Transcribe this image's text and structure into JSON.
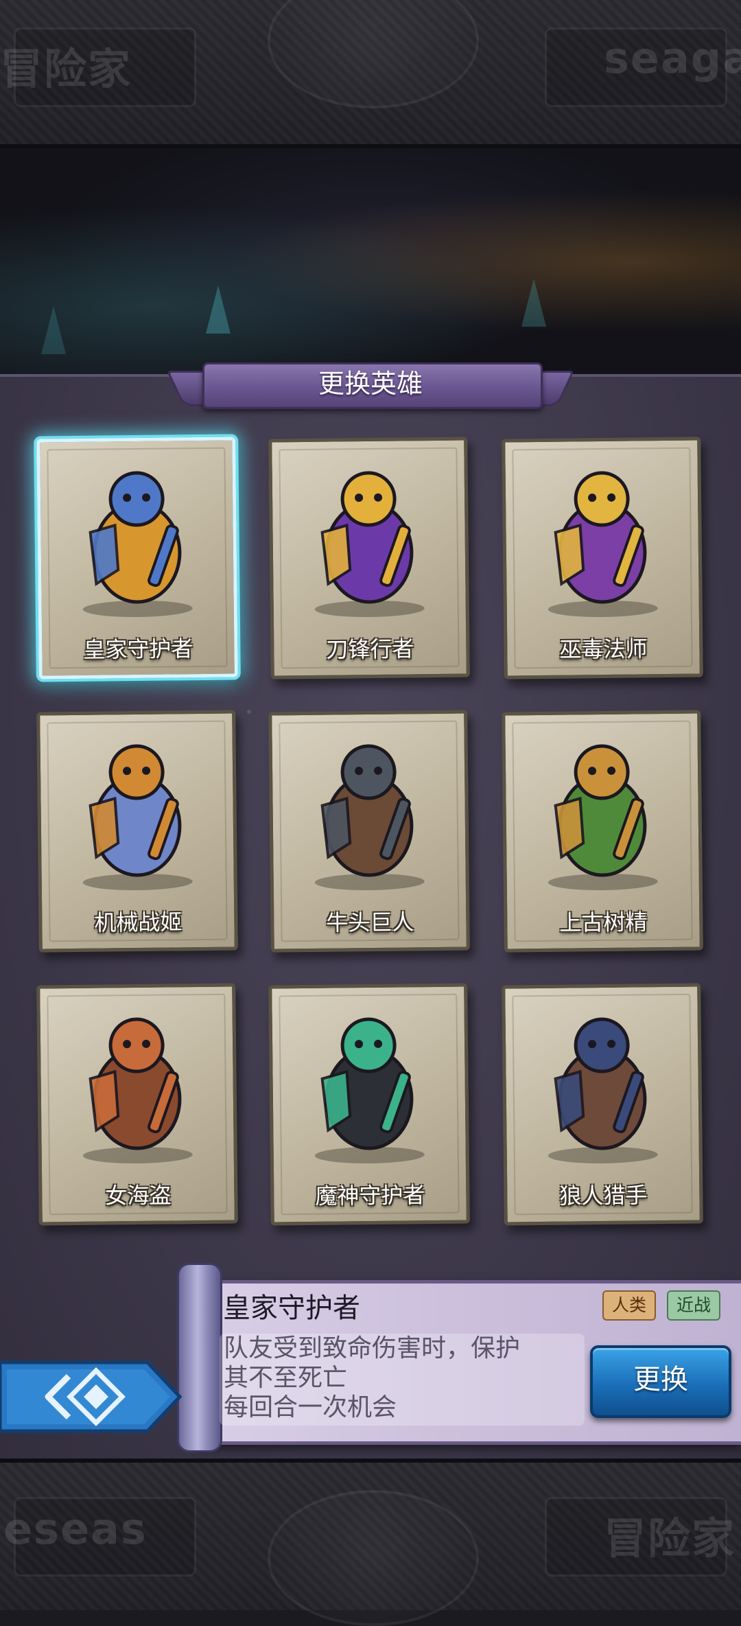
{
  "frame": {
    "top_left_text": "冒险家",
    "top_right_text": "seaga",
    "bottom_left_text": "eseas",
    "bottom_right_text": "冒险家"
  },
  "dialog": {
    "title": "更换英雄"
  },
  "heroes": [
    {
      "name": "皇家守护者",
      "selected": true,
      "theme": "#d8962f",
      "accent": "#4f79c8"
    },
    {
      "name": "刀锋行者",
      "selected": false,
      "theme": "#6b3aa8",
      "accent": "#e3b03c"
    },
    {
      "name": "巫毒法师",
      "selected": false,
      "theme": "#7b3fa6",
      "accent": "#e2b440"
    },
    {
      "name": "机械战姬",
      "selected": false,
      "theme": "#6f86c9",
      "accent": "#d18a33"
    },
    {
      "name": "牛头巨人",
      "selected": false,
      "theme": "#6b4a36",
      "accent": "#4d5560"
    },
    {
      "name": "上古树精",
      "selected": false,
      "theme": "#4f8a3a",
      "accent": "#c9923a"
    },
    {
      "name": "女海盗",
      "selected": false,
      "theme": "#8a4a2e",
      "accent": "#c76b3a"
    },
    {
      "name": "魔神守护者",
      "selected": false,
      "theme": "#2c2f36",
      "accent": "#3bb28a"
    },
    {
      "name": "狼人猎手",
      "selected": false,
      "theme": "#6e4a3a",
      "accent": "#3a4a7a"
    }
  ],
  "selected_hero": {
    "name": "皇家守护者",
    "tags": {
      "race": "人类",
      "role": "近战"
    },
    "description": "队友受到致命伤害时，保护\n其不至死亡\n每回合一次机会"
  },
  "actions": {
    "swap_label": "更换"
  },
  "icons": {
    "back": "diamond-back-icon"
  }
}
